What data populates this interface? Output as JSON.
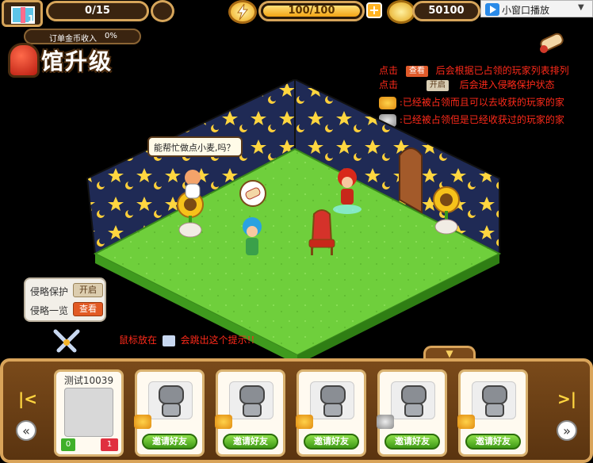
{
  "top": {
    "level": "1",
    "task_progress": "0/15",
    "energy": "100/100",
    "gold": "50100",
    "window_play_label": "小窗口播放"
  },
  "left_panel": {
    "income_label": "订单金币收入",
    "income_percent": "0%",
    "upgrade_title": "馆升级"
  },
  "hints": {
    "line1_prefix": "点击",
    "line1_tag": "查看",
    "line1_suffix": "后会根据已占领的玩家列表排列",
    "line2_prefix": "点击",
    "line2_tag": "开启",
    "line2_suffix": "后会进入侵略保护状态",
    "line3": ":已经被占领而且可以去收获的玩家的家",
    "line4": ":已经被占领但是已经收获过的玩家的家"
  },
  "speech_bubble": "能帮忙做点小麦,吗？",
  "invasion_panel": {
    "protect_label": "侵略保护",
    "protect_button": "开启",
    "list_label": "侵略一览",
    "list_button": "查看"
  },
  "mouse_hint": {
    "prefix": "鼠标放在",
    "suffix": "会跳出这个提示!!"
  },
  "friends": {
    "player_name": "测试10039",
    "player_badge_left": "0",
    "player_badge_right": "1",
    "invite_label": "邀请好友",
    "slots": [
      {
        "invite": "邀请好友",
        "status": "gold"
      },
      {
        "invite": "邀请好友",
        "status": "gold"
      },
      {
        "invite": "邀请好友",
        "status": "gold"
      },
      {
        "invite": "邀请好友",
        "status": "gray"
      },
      {
        "invite": "邀请好友",
        "status": "gold"
      }
    ]
  },
  "colors": {
    "grass": "#6fcf3c",
    "wall": "#1f2a55",
    "frame": "#d9a45a",
    "hint_red": "#ff2a1a"
  }
}
